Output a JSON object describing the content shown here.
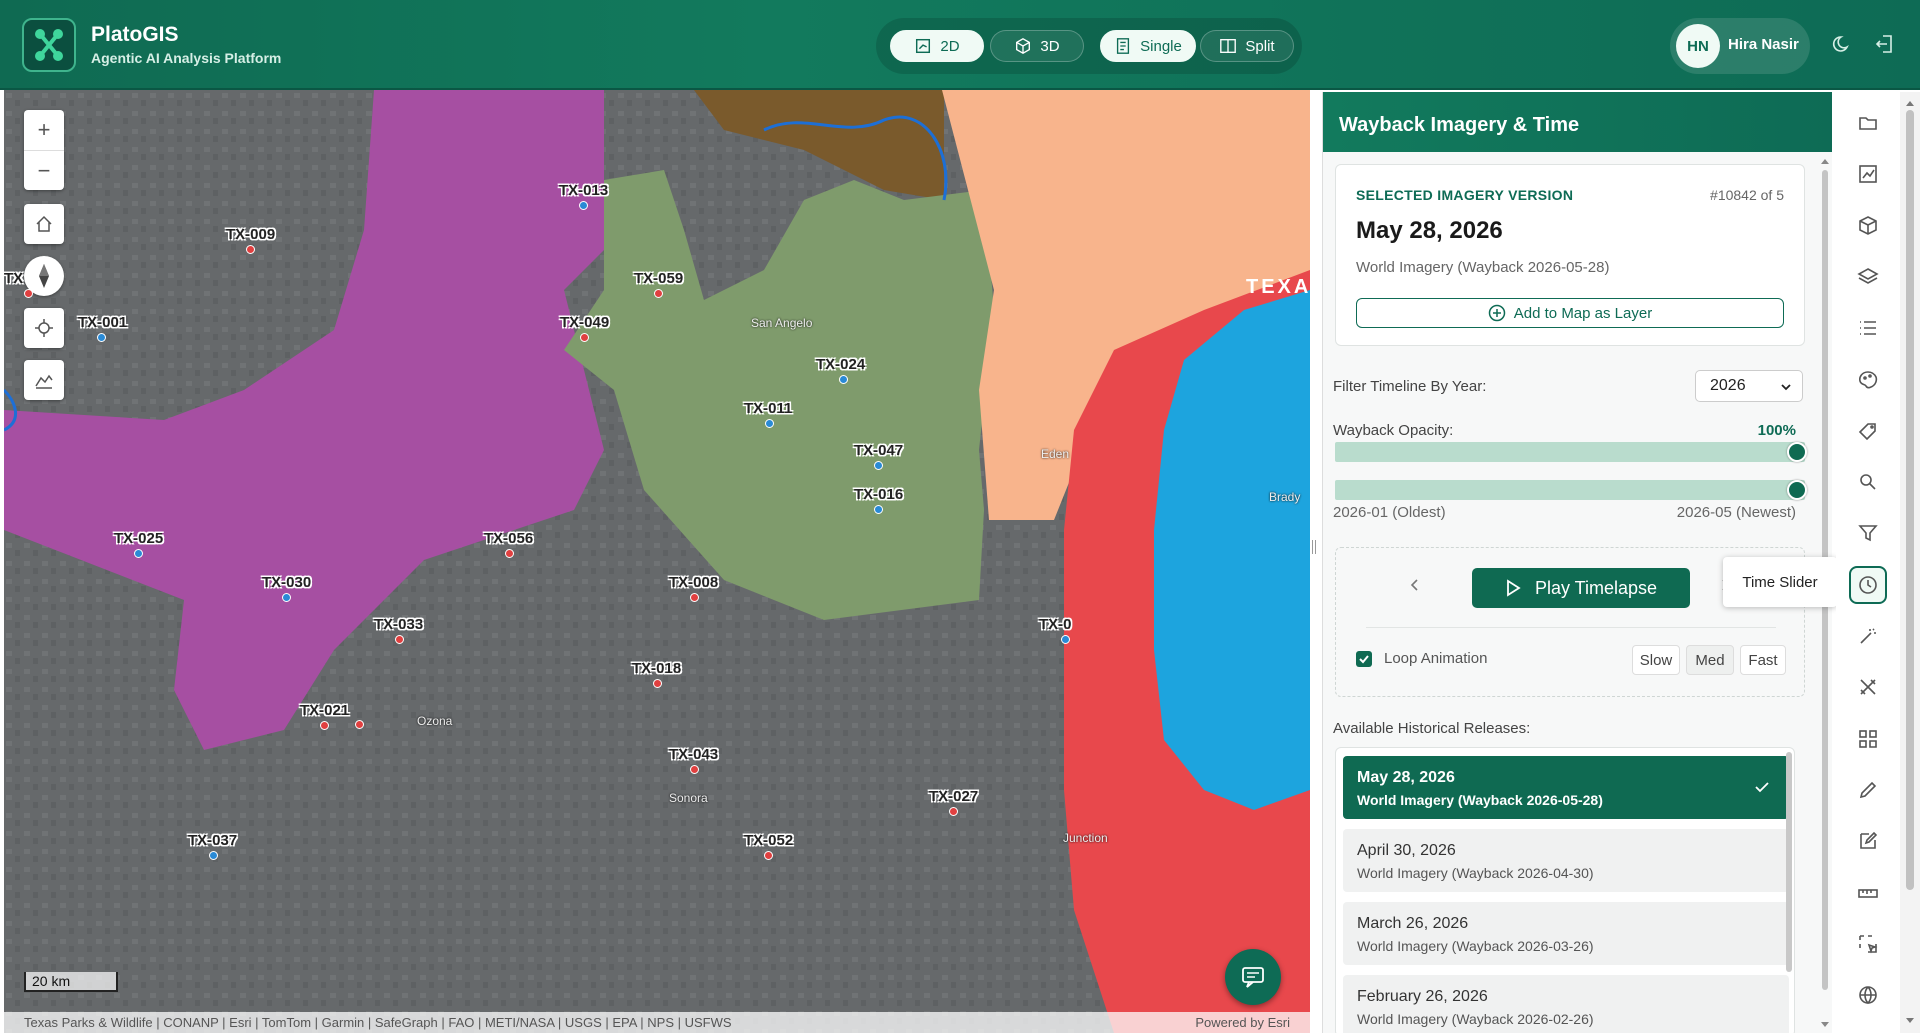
{
  "header": {
    "app_name": "PlatoGIS",
    "app_subtitle": "Agentic AI Analysis Platform",
    "modes": [
      {
        "label": "2D",
        "active": true
      },
      {
        "label": "3D",
        "active": false
      },
      {
        "label": "Single",
        "active": true
      },
      {
        "label": "Split",
        "active": false
      }
    ],
    "user_initials": "HN",
    "user_name": "Hira Nasir",
    "icons": [
      "moon-icon",
      "logout-icon"
    ]
  },
  "map": {
    "scale_label": "20 km",
    "attribution": "Texas Parks & Wildlife | CONANP | Esri | TomTom | Garmin | SafeGraph | FAO | METI/NASA | USGS | EPA | NPS | USFWS",
    "powered_by": "Powered by Esri",
    "region_label": "TEXA",
    "towns": [
      "San Angelo",
      "Eden",
      "Brady",
      "Ozona",
      "Sonora",
      "Junction"
    ],
    "points": [
      {
        "id": "TX-013",
        "color": "#2a8ad6"
      },
      {
        "id": "TX-009",
        "color": "#e04040"
      },
      {
        "id": "TX-059",
        "color": "#e04040"
      },
      {
        "id": "TX-001",
        "color": "#2a8ad6"
      },
      {
        "id": "TX-049",
        "color": "#e04040"
      },
      {
        "id": "TX-024",
        "color": "#2a8ad6"
      },
      {
        "id": "TX-011",
        "color": "#2a8ad6"
      },
      {
        "id": "TX-047",
        "color": "#2a8ad6"
      },
      {
        "id": "TX-016",
        "color": "#2a8ad6"
      },
      {
        "id": "TX-025",
        "color": "#2a8ad6"
      },
      {
        "id": "TX-056",
        "color": "#e04040"
      },
      {
        "id": "TX-030",
        "color": "#2a8ad6"
      },
      {
        "id": "TX-008",
        "color": "#e04040"
      },
      {
        "id": "TX-033",
        "color": "#e04040"
      },
      {
        "id": "TX-018",
        "color": "#e04040"
      },
      {
        "id": "TX-021",
        "color": "#e04040"
      },
      {
        "id": "TX-043",
        "color": "#e04040"
      },
      {
        "id": "TX-027",
        "color": "#e04040"
      },
      {
        "id": "TX-037",
        "color": "#2a8ad6"
      },
      {
        "id": "TX-052",
        "color": "#e04040"
      },
      {
        "id": "TX-0",
        "color": "#2a8ad6"
      },
      {
        "id": "TX",
        "color": "#e04040"
      }
    ]
  },
  "panel": {
    "title": "Wayback Imagery & Time",
    "selected_label": "SELECTED IMAGERY VERSION",
    "selected_count": "#10842 of 5",
    "selected_date": "May 28, 2026",
    "selected_desc": "World Imagery (Wayback 2026-05-28)",
    "add_layer_label": "Add to Map as Layer",
    "filter_label": "Filter Timeline By Year:",
    "year_selected": "2026",
    "opacity_label": "Wayback Opacity:",
    "opacity_value": "100%",
    "range_start": "2026-01 (Oldest)",
    "range_end": "2026-05 (Newest)",
    "play_label": "Play Timelapse",
    "loop_label": "Loop Animation",
    "loop_checked": true,
    "speeds": [
      {
        "label": "Slow",
        "active": false
      },
      {
        "label": "Med",
        "active": true
      },
      {
        "label": "Fast",
        "active": false
      }
    ],
    "releases_label": "Available Historical Releases:",
    "releases": [
      {
        "date": "May 28, 2026",
        "desc": "World Imagery (Wayback 2026-05-28)",
        "active": true
      },
      {
        "date": "April 30, 2026",
        "desc": "World Imagery (Wayback 2026-04-30)",
        "active": false
      },
      {
        "date": "March 26, 2026",
        "desc": "World Imagery (Wayback 2026-03-26)",
        "active": false
      },
      {
        "date": "February 26, 2026",
        "desc": "World Imagery (Wayback 2026-02-26)",
        "active": false
      }
    ]
  },
  "tooltip": "Time Slider",
  "toolbar": [
    "folder-icon",
    "chart-icon",
    "cube-icon",
    "layers-icon",
    "list-icon",
    "palette-icon",
    "tag-icon",
    "search-icon",
    "filter-icon",
    "clock-icon",
    "magic-wand-icon",
    "tools-icon",
    "qr-icon",
    "pencil-icon",
    "edit-icon",
    "measure-icon",
    "select-icon",
    "globe-icon"
  ],
  "colors": {
    "brand": "#0e6b55",
    "accent": "#0f6a52"
  }
}
